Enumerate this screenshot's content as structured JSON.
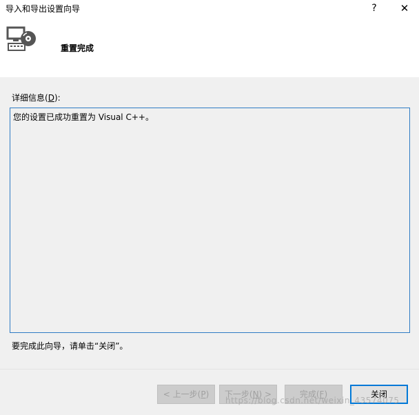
{
  "window": {
    "title": "导入和导出设置向导",
    "help_label": "?",
    "close_label": "✕"
  },
  "header": {
    "icon": "import-export-settings-icon",
    "title": "重置完成"
  },
  "details": {
    "label_prefix": "详细信息(",
    "label_accel": "D",
    "label_suffix": "):",
    "text": "您的设置已成功重置为 Visual C++。"
  },
  "instruction": "要完成此向导，请单击“关闭”。",
  "buttons": {
    "prev": {
      "prefix": "< 上一步(",
      "accel": "P",
      "suffix": ")"
    },
    "next": {
      "prefix": "下一步(",
      "accel": "N",
      "suffix": ") >"
    },
    "finish": {
      "prefix": "完成(",
      "accel": "F",
      "suffix": ")"
    },
    "close": {
      "label": "关闭"
    }
  },
  "watermark": "https://blog.csdn.net/weixin_43574075",
  "colors": {
    "accent": "#0078d7",
    "details_border": "#2e7bc4",
    "background": "#f0f0f0"
  }
}
